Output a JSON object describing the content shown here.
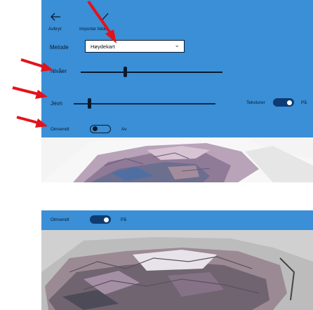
{
  "toolbar": {
    "cancel_label": "Avbryt",
    "import_label": "Importer bildet"
  },
  "method": {
    "label": "Metode",
    "value": "Høydekart"
  },
  "levels": {
    "label": "Nivåer",
    "value": 0.31
  },
  "smooth": {
    "label": "Jevn",
    "value": 0.1
  },
  "textures": {
    "label": "Teksturer",
    "state": "På"
  },
  "inverted_top": {
    "label": "Omvendt",
    "state": "Av"
  },
  "inverted_bottom": {
    "label": "Omvendt",
    "state": "På"
  },
  "colors": {
    "panel": "#3a8fd6",
    "arrow": "#e3121b",
    "toggle_on": "#0e3b72",
    "text": "#0b1a2e"
  },
  "icons": [
    "back-arrow-icon",
    "checkmark-icon",
    "chevron-down-icon"
  ]
}
